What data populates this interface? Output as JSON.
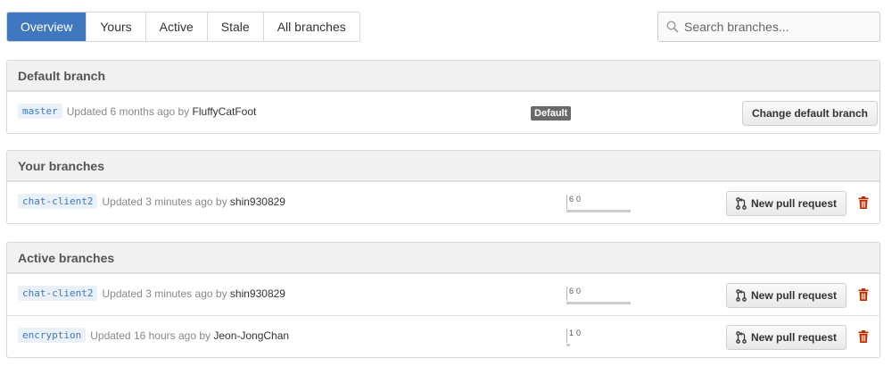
{
  "tabs": [
    {
      "label": "Overview",
      "selected": true
    },
    {
      "label": "Yours"
    },
    {
      "label": "Active"
    },
    {
      "label": "Stale"
    },
    {
      "label": "All branches"
    }
  ],
  "search": {
    "placeholder": "Search branches...",
    "icon": "search-icon"
  },
  "default_section": {
    "title": "Default branch",
    "row": {
      "branch": "master",
      "updated_prefix": "Updated 6 months ago by",
      "author": "FluffyCatFoot",
      "badge": "Default",
      "button": "Change default branch"
    }
  },
  "your_section": {
    "title": "Your branches",
    "rows": [
      {
        "branch": "chat-client2",
        "updated_prefix": "Updated 3 minutes ago by",
        "author": "shin930829",
        "behind": "0",
        "ahead": "6",
        "ahead_fraction": 1.0,
        "button": "New pull request"
      }
    ]
  },
  "active_section": {
    "title": "Active branches",
    "rows": [
      {
        "branch": "chat-client2",
        "updated_prefix": "Updated 3 minutes ago by",
        "author": "shin930829",
        "behind": "0",
        "ahead": "6",
        "ahead_fraction": 1.0,
        "button": "New pull request"
      },
      {
        "branch": "encryption",
        "updated_prefix": "Updated 16 hours ago by",
        "author": "Jeon-JongChan",
        "behind": "0",
        "ahead": "1",
        "ahead_fraction": 0.05,
        "button": "New pull request"
      }
    ]
  },
  "colors": {
    "accent": "#4078c0",
    "delete": "#bd2c00",
    "badge": "#6a6a6a"
  }
}
